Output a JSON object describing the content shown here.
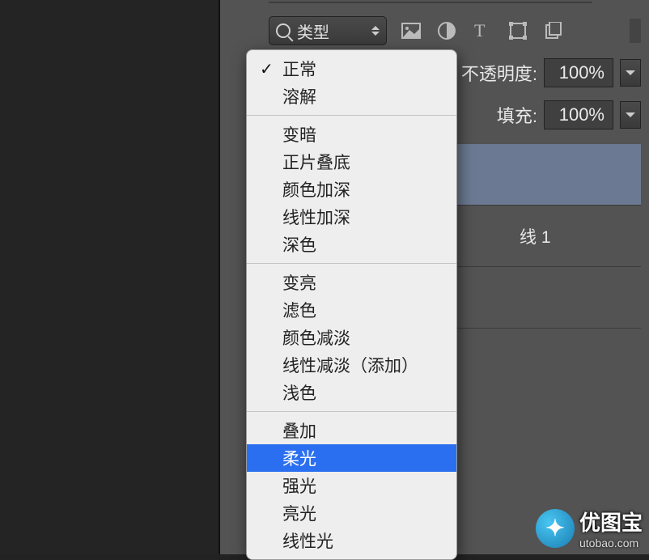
{
  "filter": {
    "type_label": "类型"
  },
  "opacity": {
    "label": "不透明度:",
    "value": "100%"
  },
  "fill": {
    "label": "填充:",
    "value": "100%"
  },
  "layers": {
    "row1_partial": "",
    "row2_partial": "线 1"
  },
  "blend_menu": {
    "groups": [
      [
        {
          "label": "正常",
          "checked": true
        },
        {
          "label": "溶解"
        }
      ],
      [
        {
          "label": "变暗"
        },
        {
          "label": "正片叠底"
        },
        {
          "label": "颜色加深"
        },
        {
          "label": "线性加深"
        },
        {
          "label": "深色"
        }
      ],
      [
        {
          "label": "变亮"
        },
        {
          "label": "滤色"
        },
        {
          "label": "颜色减淡"
        },
        {
          "label": "线性减淡（添加）"
        },
        {
          "label": "浅色"
        }
      ],
      [
        {
          "label": "叠加"
        },
        {
          "label": "柔光",
          "highlight": true
        },
        {
          "label": "强光"
        },
        {
          "label": "亮光"
        },
        {
          "label": "线性光"
        }
      ]
    ]
  },
  "watermark": {
    "brand": "优图宝",
    "url": "utobao.com"
  }
}
